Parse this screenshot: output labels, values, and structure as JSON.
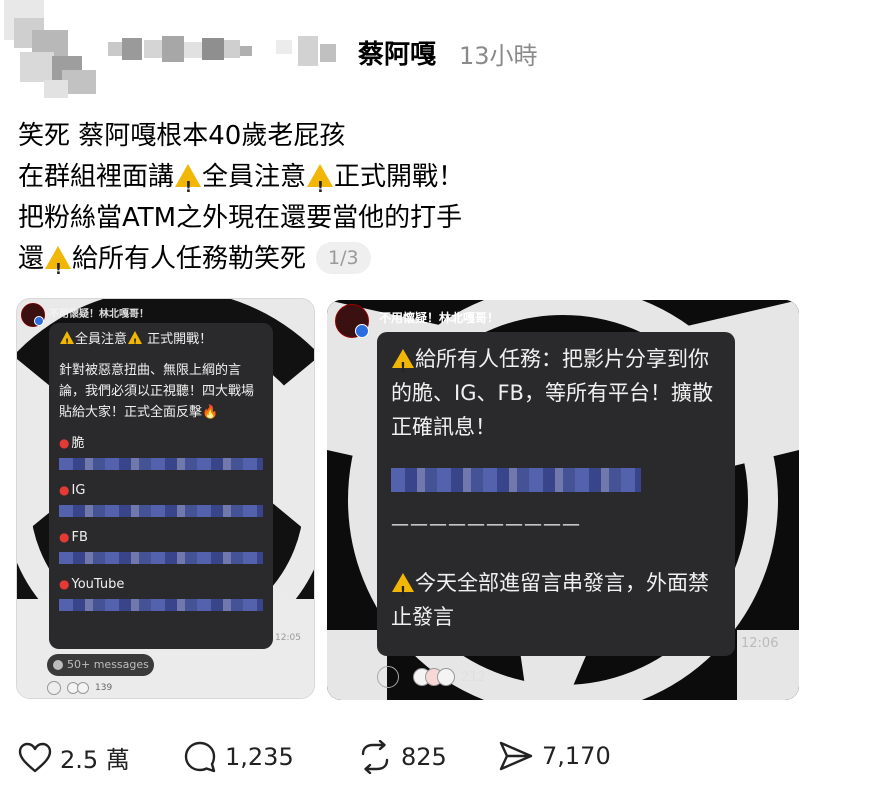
{
  "post": {
    "username": "蔡阿嘎",
    "timestamp": "13小時",
    "lines": [
      [
        "笑死 蔡阿嘎根本40歲老屁孩"
      ],
      [
        "在群組裡面講",
        "全員注意",
        "正式開戰！"
      ],
      [
        "把粉絲當ATM之外現在還要當他的打手"
      ],
      [
        "還",
        "給所有人任務勒笑死"
      ]
    ],
    "page_indicator": "1/3"
  },
  "image1": {
    "chat_header": "不用懷疑！林北嘎哥！",
    "title_a": "全員注意",
    "title_b": "正式開戰！",
    "body": "針對被惡意扭曲、無限上綱的言論，我們必須以正視聽！四大戰場貼給大家！正式全面反擊",
    "platforms": [
      "脆",
      "IG",
      "FB",
      "YouTube"
    ],
    "time": "12:05",
    "messages_badge": "50+ messages",
    "reaction_count": "139"
  },
  "image2": {
    "chat_header": "不用懷疑！林北嘎哥！",
    "task_text": "給所有人任務：把影片分享到你的脆、IG、FB，等所有平台！擴散正確訊息！",
    "divider": "——————————",
    "notice_text": "今天全部進留言串發言，外面禁止發言",
    "time": "12:06",
    "reaction_count": "212"
  },
  "actions": {
    "likes": "2.5 萬",
    "comments": "1,235",
    "reposts": "825",
    "shares": "7,170"
  },
  "colors": {
    "warning": "#f2b705",
    "bubble": "#2a2a2c",
    "blurred_link": "#5b6cc4",
    "timestamp_gray": "#8a8a8a"
  }
}
